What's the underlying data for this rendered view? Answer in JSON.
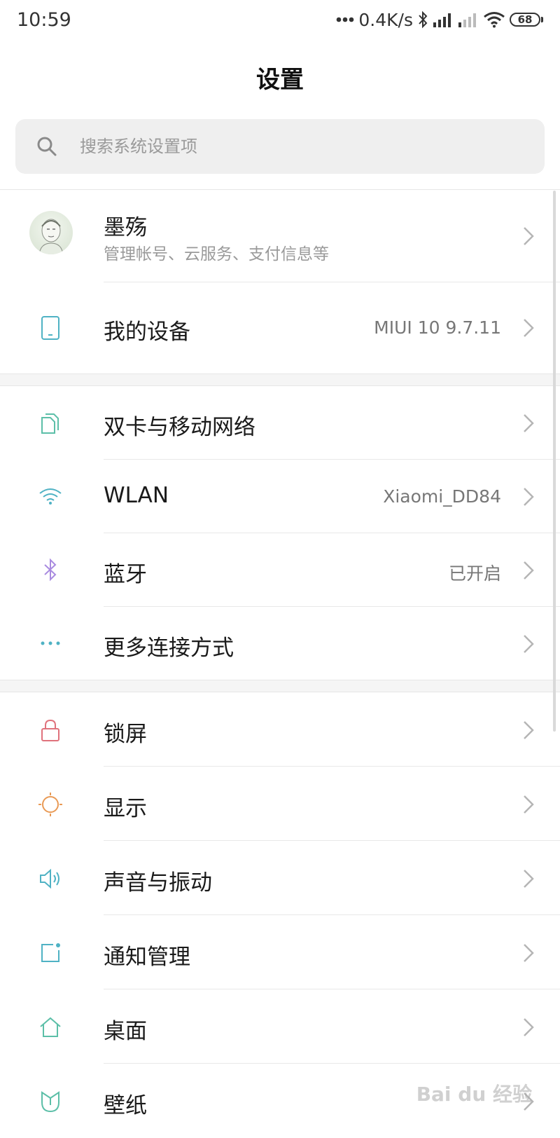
{
  "status_bar": {
    "time": "10:59",
    "net_speed": "0.4K/s",
    "battery": "68"
  },
  "header": {
    "title": "设置"
  },
  "search": {
    "placeholder": "搜索系统设置项"
  },
  "account": {
    "name": "墨殇",
    "subtitle": "管理帐号、云服务、支付信息等"
  },
  "device": {
    "label": "我的设备",
    "value": "MIUI 10 9.7.11"
  },
  "network": {
    "items": [
      {
        "label": "双卡与移动网络",
        "value": "",
        "icon": "dual-sim-icon"
      },
      {
        "label": "WLAN",
        "value": "Xiaomi_DD84",
        "icon": "wifi-icon"
      },
      {
        "label": "蓝牙",
        "value": "已开启",
        "icon": "bluetooth-icon"
      },
      {
        "label": "更多连接方式",
        "value": "",
        "icon": "more-dots-icon"
      }
    ]
  },
  "personal": {
    "items": [
      {
        "label": "锁屏",
        "icon": "lock-icon"
      },
      {
        "label": "显示",
        "icon": "sun-icon"
      },
      {
        "label": "声音与振动",
        "icon": "speaker-icon"
      },
      {
        "label": "通知管理",
        "icon": "notification-icon"
      },
      {
        "label": "桌面",
        "icon": "home-icon"
      },
      {
        "label": "壁纸",
        "icon": "wallpaper-icon"
      }
    ]
  },
  "colors": {
    "teal_icon": "#4fb2c4",
    "purple_icon": "#a98be0",
    "red_icon": "#e0727c",
    "orange_icon": "#e99a55",
    "green_icon": "#5cbfa8"
  },
  "watermark": "Bai du 经验"
}
